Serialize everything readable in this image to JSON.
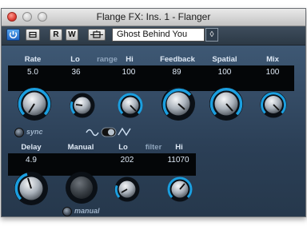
{
  "window": {
    "title": "Flange FX: Ins. 1 - Flanger"
  },
  "toolbar": {
    "power_icon": "power-icon",
    "bypass_icon": "bypass-icon",
    "read_label": "R",
    "write_label": "W",
    "compare_icon": "compare-icon",
    "preset_name": "Ghost Behind You",
    "preset_menu_icon": "diamond-icon"
  },
  "row1": {
    "rate": {
      "label": "Rate",
      "value": "5.0"
    },
    "lo": {
      "label": "Lo",
      "value": "36"
    },
    "range_label": "range",
    "hi": {
      "label": "Hi",
      "value": "100"
    },
    "feedback": {
      "label": "Feedback",
      "value": "89"
    },
    "spatial": {
      "label": "Spatial",
      "value": "100"
    },
    "mix": {
      "label": "Mix",
      "value": "100"
    },
    "sync_label": "sync",
    "waveform": "triangle"
  },
  "row2": {
    "delay": {
      "label": "Delay",
      "value": "4.9"
    },
    "manual": {
      "label": "Manual",
      "value": ""
    },
    "lo": {
      "label": "Lo",
      "value": "202"
    },
    "filter_label": "filter",
    "hi": {
      "label": "Hi",
      "value": "11070"
    },
    "manual_toggle_label": "manual"
  },
  "colors": {
    "accent": "#1b9fe0",
    "panel": "#2e3f52",
    "display": "#040608"
  }
}
